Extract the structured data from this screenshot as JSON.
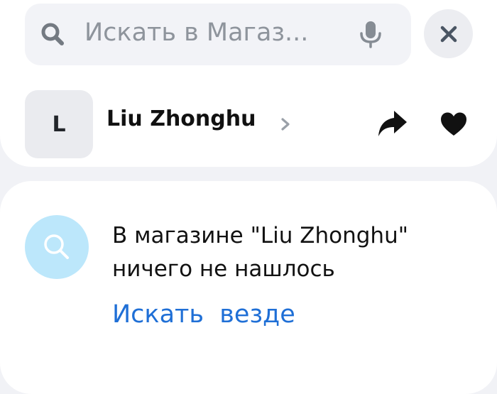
{
  "search": {
    "placeholder": "Искать в Магаз...",
    "icons": {
      "search": "search-icon",
      "mic": "microphone-icon",
      "close": "close-icon"
    }
  },
  "store": {
    "avatar_letter": "L",
    "name": "Liu Zhonghu",
    "icons": {
      "chevron": "chevron-right-icon",
      "share": "share-icon",
      "like": "heart-icon"
    }
  },
  "empty_state": {
    "message": "В магазине \"Liu Zhonghu\" ничего не нашлось",
    "action_label": "Искать  везде",
    "icon": "search-icon"
  },
  "colors": {
    "background": "#f1f2f6",
    "card": "#ffffff",
    "search_bar": "#f2f3f7",
    "muted_text": "#8e949c",
    "link": "#1f6fd6",
    "empty_icon_bg": "#bce7fb",
    "empty_icon_fg": "#ffffff"
  }
}
